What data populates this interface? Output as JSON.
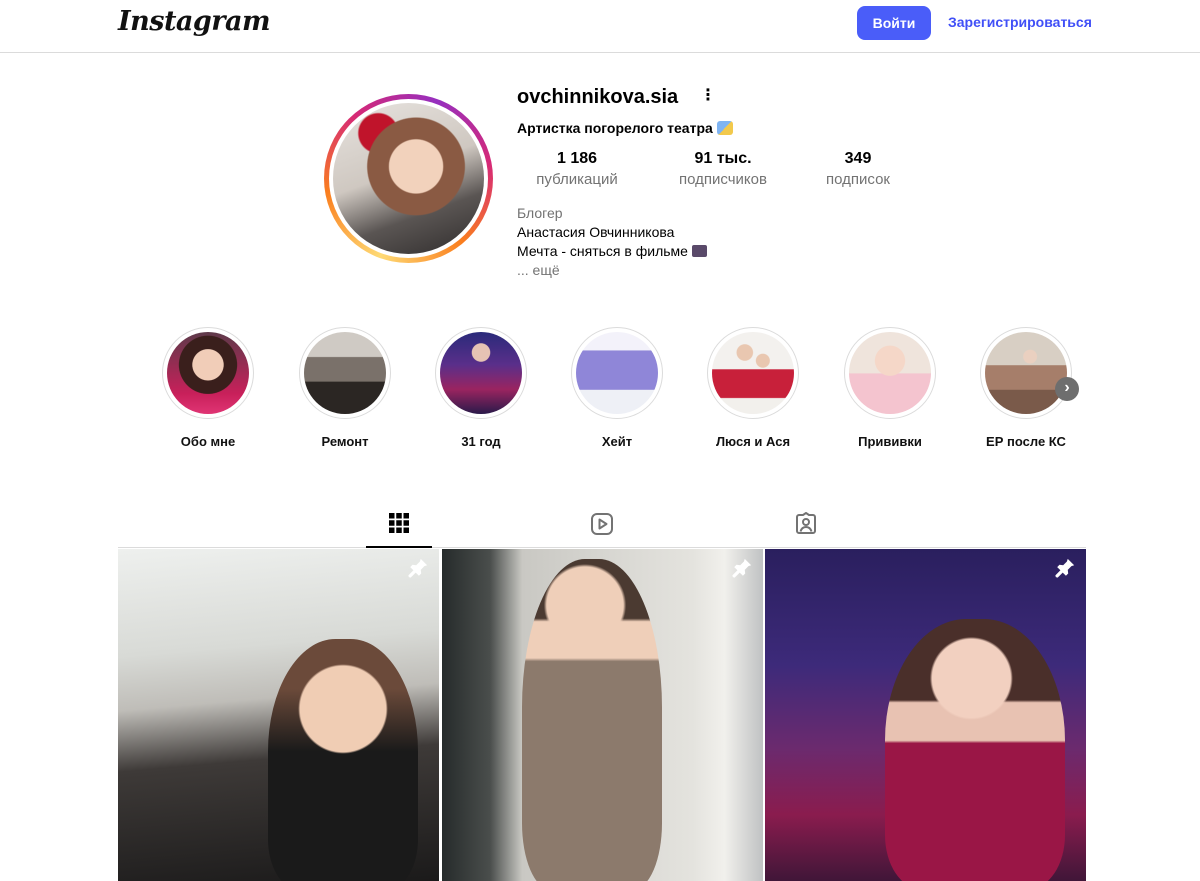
{
  "header": {
    "logo": "Instagram",
    "login_label": "Войти",
    "signup_label": "Зарегистрироваться"
  },
  "profile": {
    "username": "ovchinnikova.sia",
    "tagline": "Артистка погорелого театра",
    "stats": [
      {
        "value": "1 186",
        "label": "публикаций"
      },
      {
        "value": "91 тыс.",
        "label": "подписчиков"
      },
      {
        "value": "349",
        "label": "подписок"
      }
    ],
    "bio": {
      "category": "Блогер",
      "name": "Анастасия Овчинникова",
      "dream": "Мечта - сняться в фильме",
      "more": "... ещё"
    }
  },
  "highlights": [
    {
      "label": "Обо мне"
    },
    {
      "label": "Ремонт"
    },
    {
      "label": "31 год"
    },
    {
      "label": "Хейт"
    },
    {
      "label": "Люся и Ася"
    },
    {
      "label": "Прививки"
    },
    {
      "label": "ЕР после КС"
    }
  ],
  "tabs": [
    {
      "icon": "grid-icon",
      "active": true
    },
    {
      "icon": "reels-icon",
      "active": false
    },
    {
      "icon": "tagged-icon",
      "active": false
    }
  ],
  "posts": [
    {
      "pinned": true
    },
    {
      "pinned": true
    },
    {
      "pinned": true
    }
  ],
  "colors": {
    "login_button": "#4a5df9",
    "signup_link": "#4150f7",
    "muted_text": "#737373",
    "border": "#dbdbdb"
  }
}
